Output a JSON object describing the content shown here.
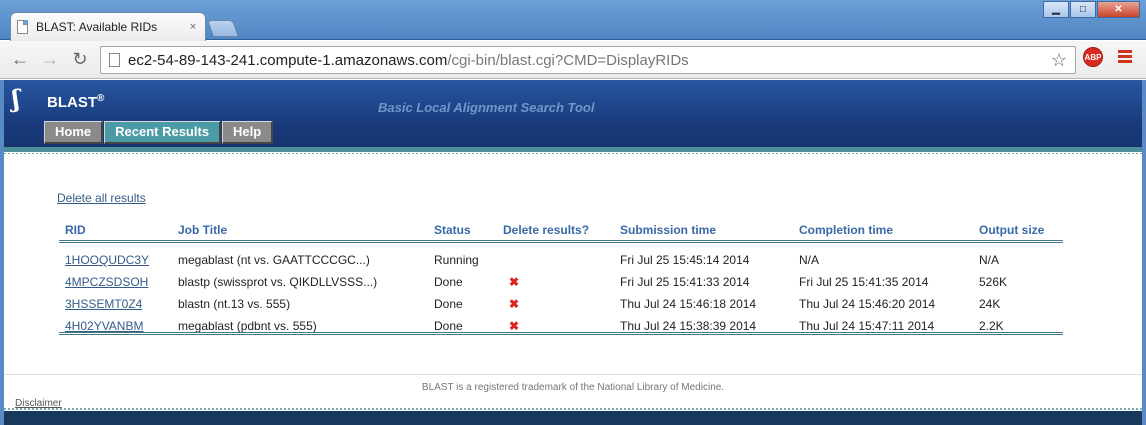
{
  "browser": {
    "tab_title": "BLAST: Available RIDs",
    "tab_close": "×",
    "url_host": "ec2-54-89-143-241.compute-1.amazonaws.com",
    "url_path": "/cgi-bin/blast.cgi?CMD=DisplayRIDs",
    "back_icon": "←",
    "forward_icon": "→",
    "reload_icon": "↻",
    "star_icon": "☆",
    "abp_label": "ABP",
    "win_min": "▁",
    "win_max": "□",
    "win_close": "✕"
  },
  "header": {
    "logo_glyph": "ʃ",
    "title": "BLAST",
    "registered": "®",
    "tagline": "Basic Local Alignment Search Tool",
    "tabs": [
      {
        "label": "Home"
      },
      {
        "label": "Recent Results"
      },
      {
        "label": "Help"
      }
    ]
  },
  "main": {
    "delete_all_label": "Delete all results",
    "columns": [
      "RID",
      "Job Title",
      "Status",
      "Delete results?",
      "Submission time",
      "Completion time",
      "Output size"
    ],
    "rows": [
      {
        "rid": "1HOOQUDC3Y",
        "title": "megablast (nt vs. GAATTCCCGC...)",
        "status": "Running",
        "delete": "",
        "submitted": "Fri Jul 25 15:45:14 2014",
        "completed": "N/A",
        "size": "N/A"
      },
      {
        "rid": "4MPCZSDSOH",
        "title": "blastp (swissprot vs. QIKDLLVSSS...)",
        "status": "Done",
        "delete": "✖",
        "submitted": "Fri Jul 25 15:41:33 2014",
        "completed": "Fri Jul 25 15:41:35 2014",
        "size": "526K"
      },
      {
        "rid": "3HSSEMT0Z4",
        "title": "blastn (nt.13 vs. 555)",
        "status": "Done",
        "delete": "✖",
        "submitted": "Thu Jul 24 15:46:18 2014",
        "completed": "Thu Jul 24 15:46:20 2014",
        "size": "24K"
      },
      {
        "rid": "4H02YVANBM",
        "title": "megablast (pdbnt vs. 555)",
        "status": "Done",
        "delete": "✖",
        "submitted": "Thu Jul 24 15:38:39 2014",
        "completed": "Thu Jul 24 15:47:11 2014",
        "size": "2.2K"
      }
    ]
  },
  "footer": {
    "trademark": "BLAST is a registered trademark of the National Library of Medicine.",
    "disclaimer": "Disclaimer"
  },
  "colors": {
    "header_blue": "#19397a",
    "active_tab": "#4a9ba5",
    "link": "#335c8a",
    "delete_x": "#dd2222"
  }
}
